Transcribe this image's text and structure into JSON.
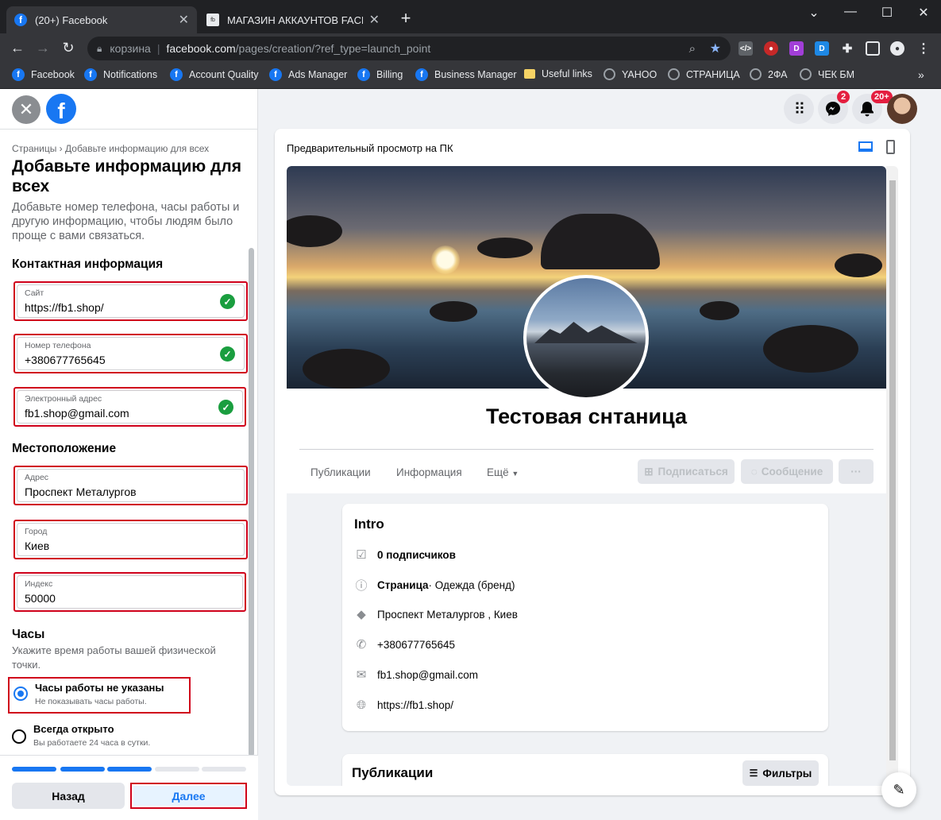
{
  "browser": {
    "tabs": [
      {
        "title": "(20+) Facebook",
        "active": true
      },
      {
        "title": "МАГАЗИН АККАУНТОВ FACEBOOK",
        "active": false
      }
    ],
    "url_chip": "корзина",
    "url_host": "facebook.com",
    "url_path": "/pages/creation/?ref_type=launch_point",
    "bookmarks": [
      "Facebook",
      "Notifications",
      "Account Quality",
      "Ads Manager",
      "Billing",
      "Business Manager",
      "Useful links",
      "YAHOO",
      "СТРАНИЦА",
      "2ФА",
      "ЧЕК БМ"
    ]
  },
  "left": {
    "breadcrumb": "Страницы › Добавьте информацию для всех",
    "title": "Добавьте информацию для всех",
    "description": "Добавьте номер телефона, часы работы и другую информацию, чтобы людям было проще с вами связаться.",
    "contact_heading": "Контактная информация",
    "fields": {
      "site": {
        "label": "Сайт",
        "value": "https://fb1.shop/"
      },
      "phone": {
        "label": "Номер телефона",
        "value": "+380677765645"
      },
      "email": {
        "label": "Электронный адрес",
        "value": "fb1.shop@gmail.com"
      },
      "address": {
        "label": "Адрес",
        "value": "Проспект Металургов"
      },
      "city": {
        "label": "Город",
        "value": "Киев"
      },
      "zip": {
        "label": "Индекс",
        "value": "50000"
      }
    },
    "location_heading": "Местоположение",
    "hours_heading": "Часы",
    "hours_desc": "Укажите время работы вашей физической точки.",
    "hours_options": [
      {
        "title": "Часы работы не указаны",
        "sub": "Не показывать часы работы.",
        "selected": true
      },
      {
        "title": "Всегда открыто",
        "sub": "Вы работаете 24 часа в сутки.",
        "selected": false
      }
    ],
    "progress": {
      "done": 3,
      "total": 5
    },
    "back": "Назад",
    "next": "Далее"
  },
  "header_right": {
    "messenger_badge": "2",
    "notif_badge": "20+"
  },
  "preview": {
    "title": "Предварительный просмотр на ПК",
    "page_name": "Тестовая снтаница",
    "tabs": [
      "Публикации",
      "Информация",
      "Ещё"
    ],
    "buttons": {
      "follow": "Подписаться",
      "message": "Сообщение",
      "more": "···"
    },
    "intro": {
      "heading": "Intro",
      "followers": "0 подписчиков",
      "category_bold": "Страница",
      "category_rest": " · Одежда (бренд)",
      "address": "Проспект Металургов , Киев",
      "phone": "+380677765645",
      "email": "fb1.shop@gmail.com",
      "website": "https://fb1.shop/"
    },
    "posts_heading": "Публикации",
    "filters": "Фильтры"
  },
  "colors": {
    "accent": "#1877f2",
    "highlight_border": "#d0021b",
    "success": "#1a9e3f"
  }
}
